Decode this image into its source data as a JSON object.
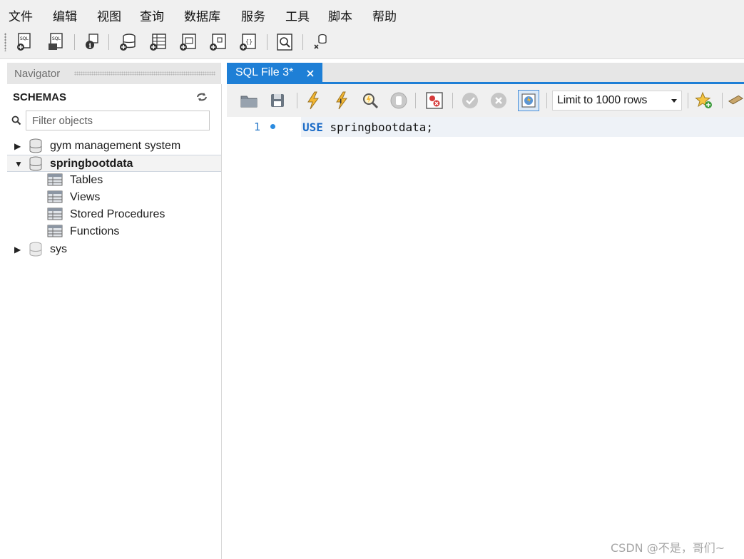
{
  "menu": [
    "文件",
    "编辑",
    "视图",
    "查询",
    "数据库",
    "服务",
    "工具",
    "脚本",
    "帮助"
  ],
  "toolbar": {
    "icons": [
      "new-sql-tab-icon",
      "open-sql-script-icon",
      "schema-inspector-icon",
      "create-schema-icon",
      "create-table-icon",
      "create-view-icon",
      "create-procedure-icon",
      "create-function-icon",
      "search-data-icon",
      "reconnect-icon"
    ]
  },
  "navigator": {
    "title": "Navigator",
    "schemas_label": "SCHEMAS",
    "filter_placeholder": "Filter objects",
    "schemas": [
      {
        "name": "gym management system",
        "expanded": false
      },
      {
        "name": "springbootdata",
        "expanded": true,
        "children": [
          "Tables",
          "Views",
          "Stored Procedures",
          "Functions"
        ]
      },
      {
        "name": "sys",
        "expanded": false
      }
    ]
  },
  "editor": {
    "tab_label": "SQL File 3*",
    "limit_label": "Limit to 1000 rows",
    "lines": [
      {
        "number": "1",
        "keyword": "USE",
        "rest": " springbootdata;"
      }
    ]
  },
  "watermark": "CSDN @不是，哥们~",
  "colors": {
    "accent": "#1e7fd6",
    "keyword": "#1c6cc7"
  }
}
